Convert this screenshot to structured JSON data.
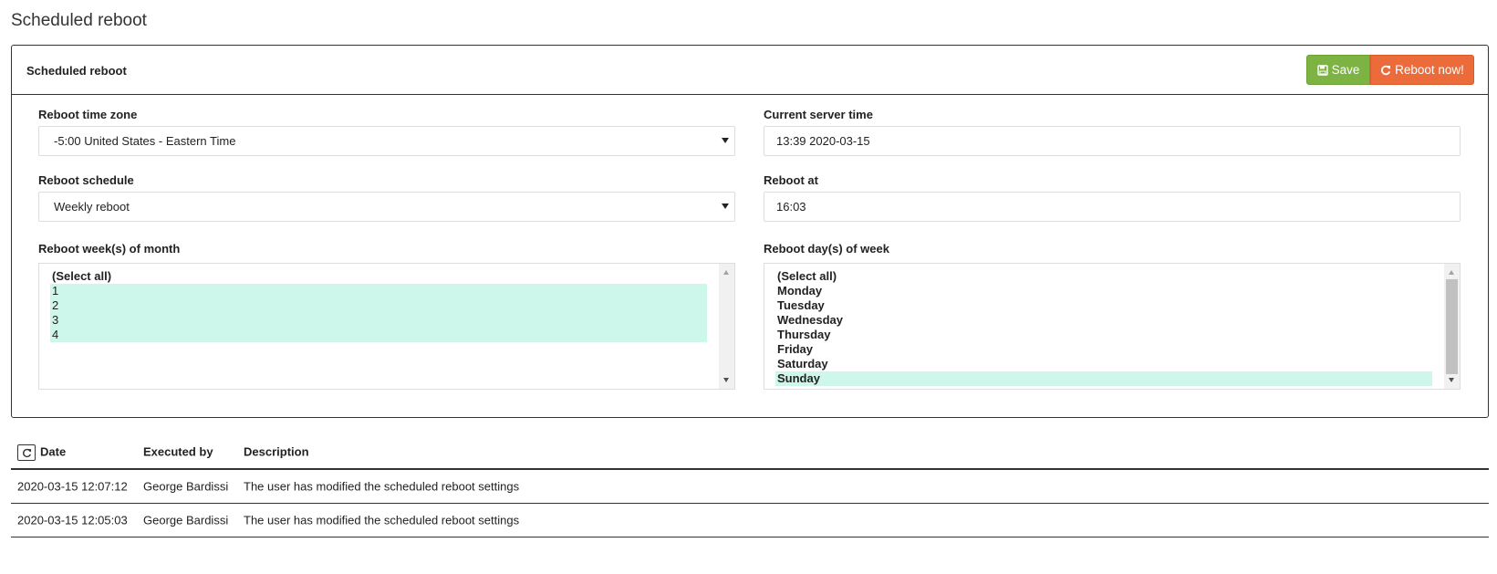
{
  "page": {
    "title": "Scheduled reboot"
  },
  "panel": {
    "heading": "Scheduled reboot",
    "save_label": "Save",
    "reboot_label": "Reboot now!"
  },
  "fields": {
    "timezone_label": "Reboot time zone",
    "timezone_value": "-5:00 United States - Eastern Time",
    "server_time_label": "Current server time",
    "server_time_value": "13:39 2020-03-15",
    "schedule_label": "Reboot schedule",
    "schedule_value": "Weekly reboot",
    "reboot_at_label": "Reboot at",
    "reboot_at_value": "16:03",
    "weeks_label": "Reboot week(s) of month",
    "weeks_options": [
      "(Select all)",
      "1",
      "2",
      "3",
      "4"
    ],
    "weeks_selected": [
      "1",
      "2",
      "3",
      "4"
    ],
    "days_label": "Reboot day(s) of week",
    "days_options": [
      "(Select all)",
      "Monday",
      "Tuesday",
      "Wednesday",
      "Thursday",
      "Friday",
      "Saturday",
      "Sunday"
    ],
    "days_selected": [
      "Sunday"
    ]
  },
  "log": {
    "columns": [
      "Date",
      "Executed by",
      "Description"
    ],
    "rows": [
      {
        "date": "2020-03-15 12:07:12",
        "user": "George Bardissi",
        "description": "The user has modified the scheduled reboot settings"
      },
      {
        "date": "2020-03-15 12:05:03",
        "user": "George Bardissi",
        "description": "The user has modified the scheduled reboot settings"
      }
    ]
  },
  "colors": {
    "save": "#7cb342",
    "reboot": "#ec6b3b",
    "selection": "#ccf7ea"
  },
  "icons": {
    "save": "floppy-disk-icon",
    "reboot": "refresh-icon",
    "refresh": "refresh-icon"
  }
}
